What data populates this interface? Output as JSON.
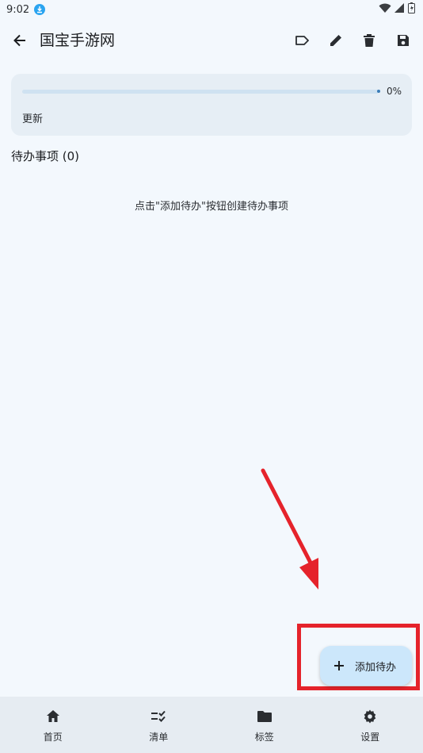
{
  "status_bar": {
    "time": "9:02"
  },
  "app_bar": {
    "title": "国宝手游网"
  },
  "progress": {
    "percent_label": "0%",
    "value": 0,
    "update_label": "更新"
  },
  "todo": {
    "header": "待办事项 (0)",
    "empty_hint": "点击\"添加待办\"按钮创建待办事项"
  },
  "fab": {
    "label": "添加待办"
  },
  "bottom_nav": [
    {
      "label": "首页",
      "icon": "home-icon"
    },
    {
      "label": "清单",
      "icon": "checklist-icon"
    },
    {
      "label": "标签",
      "icon": "folder-icon"
    },
    {
      "label": "设置",
      "icon": "gear-icon"
    }
  ],
  "colors": {
    "annotation": "#e5232b",
    "fab_bg": "#cce7fb",
    "background": "#f3f8fd",
    "card": "#e6eef5"
  }
}
